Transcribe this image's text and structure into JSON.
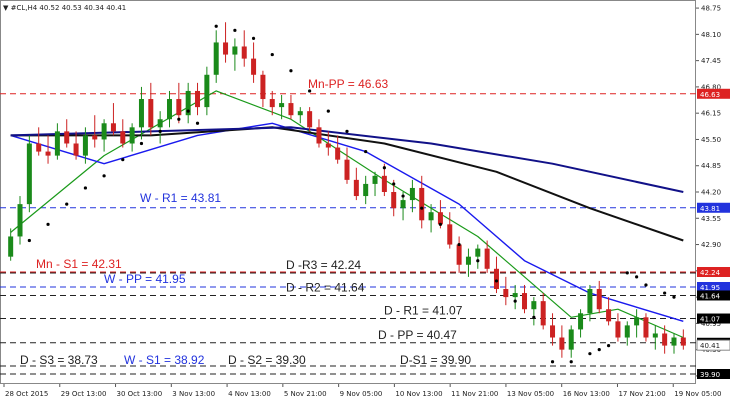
{
  "chart_data": {
    "type": "candlestick",
    "symbol_header": "▼ #CL,H4  40.52 40.53 40.34 40.41",
    "ylim": [
      39.45,
      48.95
    ],
    "y_ticks": [
      "48.75",
      "48.10",
      "47.45",
      "46.80",
      "46.15",
      "45.50",
      "44.85",
      "44.20",
      "43.55",
      "42.90",
      "42.25",
      "41.60",
      "40.95",
      "40.30",
      "39.65"
    ],
    "x_ticks": [
      "28 Oct 2015",
      "29 Oct 13:00",
      "30 Oct 13:00",
      "3 Nov 13:00",
      "4 Nov 13:00",
      "5 Nov 21:00",
      "9 Nov 05:00",
      "10 Nov 13:00",
      "11 Nov 21:00",
      "13 Nov 05:00",
      "16 Nov 13:00",
      "17 Nov 21:00",
      "19 Nov 05:00"
    ],
    "levels": [
      {
        "label": "Mn-PP = 46.63",
        "value": 46.63,
        "color": "#dd2222",
        "style": "dash",
        "tag": "46.63"
      },
      {
        "label": "W - R1 = 43.81",
        "value": 43.81,
        "color": "#2233dd",
        "style": "dash",
        "tag": "43.81"
      },
      {
        "label": "Mn - S1 = 42.31",
        "value": 42.31,
        "color": "#dd2222",
        "style": "dash",
        "tag": "42.24"
      },
      {
        "label": "W - PP = 41.95",
        "value": 41.95,
        "color": "#2233dd",
        "style": "dash",
        "tag": "41.95"
      },
      {
        "label": "D -R3 = 42.24",
        "value": 42.24,
        "color": "#222222",
        "style": "dash",
        "tag": ""
      },
      {
        "label": "D - R2 = 41.64",
        "value": 41.64,
        "color": "#222222",
        "style": "dash",
        "tag": "41.64"
      },
      {
        "label": "D - R1 = 41.07",
        "value": 41.07,
        "color": "#222222",
        "style": "dash",
        "tag": "41.07"
      },
      {
        "label": "D - PP = 40.47",
        "value": 40.47,
        "color": "#222222",
        "style": "dash",
        "tag": "40.47"
      },
      {
        "label": "D - S3 = 38.73",
        "value": 38.73,
        "color": "#222222",
        "style": "dash",
        "tag": ""
      },
      {
        "label": "W - S1 = 38.92",
        "value": 38.92,
        "color": "#2233dd",
        "style": "dash",
        "tag": ""
      },
      {
        "label": "D - S2 = 39.30",
        "value": 39.3,
        "color": "#222222",
        "style": "dash",
        "tag": ""
      },
      {
        "label": "D-S1 = 39.90",
        "value": 39.9,
        "color": "#222222",
        "style": "dash",
        "tag": "39.90"
      }
    ],
    "current_price": {
      "value": 40.41,
      "tag": "40.41"
    },
    "candles": [
      [
        42.6,
        43.3,
        42.5,
        43.1
      ],
      [
        43.1,
        44.1,
        42.9,
        43.9
      ],
      [
        43.9,
        45.6,
        43.7,
        45.4
      ],
      [
        45.4,
        45.8,
        45.1,
        45.2
      ],
      [
        45.2,
        45.6,
        44.9,
        45.1
      ],
      [
        45.1,
        45.9,
        45.0,
        45.7
      ],
      [
        45.7,
        46.0,
        45.3,
        45.4
      ],
      [
        45.4,
        45.7,
        45.0,
        45.1
      ],
      [
        45.1,
        45.8,
        44.9,
        45.6
      ],
      [
        45.6,
        46.1,
        45.3,
        45.5
      ],
      [
        45.5,
        46.0,
        45.2,
        45.9
      ],
      [
        45.9,
        46.4,
        45.6,
        45.7
      ],
      [
        45.7,
        46.0,
        45.3,
        45.4
      ],
      [
        45.4,
        45.9,
        45.2,
        45.8
      ],
      [
        45.8,
        46.8,
        45.5,
        46.5
      ],
      [
        46.5,
        46.9,
        45.6,
        45.8
      ],
      [
        45.8,
        46.2,
        45.4,
        46.0
      ],
      [
        46.0,
        46.7,
        45.8,
        46.5
      ],
      [
        46.5,
        46.9,
        45.9,
        46.1
      ],
      [
        46.1,
        46.9,
        45.9,
        46.7
      ],
      [
        46.7,
        46.9,
        46.1,
        46.3
      ],
      [
        46.3,
        47.3,
        46.1,
        47.1
      ],
      [
        47.1,
        48.2,
        46.9,
        47.9
      ],
      [
        47.9,
        48.4,
        47.4,
        47.6
      ],
      [
        47.6,
        48.0,
        47.2,
        47.8
      ],
      [
        47.8,
        48.2,
        47.3,
        47.5
      ],
      [
        47.5,
        47.9,
        46.9,
        47.1
      ],
      [
        47.1,
        47.2,
        46.3,
        46.5
      ],
      [
        46.5,
        46.7,
        46.1,
        46.3
      ],
      [
        46.3,
        46.6,
        46.0,
        46.4
      ],
      [
        46.4,
        46.6,
        46.0,
        46.1
      ],
      [
        46.1,
        46.3,
        45.9,
        46.2
      ],
      [
        46.2,
        46.3,
        45.7,
        45.8
      ],
      [
        45.8,
        46.0,
        45.3,
        45.4
      ],
      [
        45.4,
        45.7,
        45.1,
        45.3
      ],
      [
        45.3,
        45.6,
        44.9,
        45.0
      ],
      [
        45.0,
        45.3,
        44.4,
        44.5
      ],
      [
        44.5,
        44.8,
        44.0,
        44.1
      ],
      [
        44.1,
        44.6,
        43.9,
        44.4
      ],
      [
        44.4,
        44.7,
        44.1,
        44.6
      ],
      [
        44.6,
        44.9,
        44.1,
        44.2
      ],
      [
        44.2,
        44.5,
        43.6,
        43.8
      ],
      [
        43.8,
        44.2,
        43.5,
        44.0
      ],
      [
        44.0,
        44.5,
        43.7,
        44.3
      ],
      [
        44.3,
        44.6,
        43.3,
        43.5
      ],
      [
        43.5,
        43.9,
        43.2,
        43.7
      ],
      [
        43.7,
        44.0,
        43.3,
        43.4
      ],
      [
        43.4,
        43.7,
        42.8,
        42.9
      ],
      [
        42.9,
        43.1,
        42.2,
        42.4
      ],
      [
        42.4,
        42.8,
        42.1,
        42.6
      ],
      [
        42.6,
        42.9,
        42.3,
        42.8
      ],
      [
        42.8,
        43.0,
        42.2,
        42.3
      ],
      [
        42.3,
        42.6,
        41.7,
        41.8
      ],
      [
        41.8,
        42.1,
        41.4,
        41.6
      ],
      [
        41.6,
        41.9,
        41.3,
        41.7
      ],
      [
        41.7,
        41.9,
        41.2,
        41.3
      ],
      [
        41.3,
        41.6,
        40.9,
        41.5
      ],
      [
        41.5,
        41.7,
        40.8,
        40.9
      ],
      [
        40.9,
        41.2,
        40.4,
        40.6
      ],
      [
        40.6,
        40.9,
        40.1,
        40.3
      ],
      [
        40.3,
        40.9,
        40.1,
        40.8
      ],
      [
        40.8,
        41.3,
        40.6,
        41.2
      ],
      [
        41.2,
        41.9,
        41.0,
        41.8
      ],
      [
        41.8,
        42.0,
        41.2,
        41.3
      ],
      [
        41.3,
        41.6,
        40.9,
        41.0
      ],
      [
        41.0,
        41.2,
        40.5,
        40.6
      ],
      [
        40.6,
        41.0,
        40.4,
        40.9
      ],
      [
        40.9,
        41.3,
        40.6,
        41.1
      ],
      [
        41.1,
        41.2,
        40.5,
        40.6
      ],
      [
        40.6,
        40.9,
        40.3,
        40.7
      ],
      [
        40.7,
        40.9,
        40.2,
        40.4
      ],
      [
        40.4,
        40.7,
        40.2,
        40.6
      ],
      [
        40.6,
        40.8,
        40.3,
        40.4
      ]
    ],
    "moving_averages": [
      {
        "color": "#1a9a1a",
        "width": 1.2,
        "points": [
          [
            0,
            43.2
          ],
          [
            10,
            45.1
          ],
          [
            22,
            46.7
          ],
          [
            30,
            46.0
          ],
          [
            40,
            44.5
          ],
          [
            50,
            43.1
          ],
          [
            60,
            41.1
          ],
          [
            65,
            41.3
          ],
          [
            72,
            40.6
          ]
        ]
      },
      {
        "color": "#1a1aee",
        "width": 1.4,
        "points": [
          [
            0,
            45.6
          ],
          [
            10,
            44.9
          ],
          [
            20,
            45.6
          ],
          [
            28,
            45.9
          ],
          [
            38,
            45.2
          ],
          [
            48,
            43.9
          ],
          [
            55,
            42.5
          ],
          [
            62,
            41.7
          ],
          [
            72,
            41.0
          ]
        ]
      },
      {
        "color": "#111111",
        "width": 2.0,
        "points": [
          [
            0,
            45.6
          ],
          [
            15,
            45.6
          ],
          [
            28,
            45.8
          ],
          [
            40,
            45.4
          ],
          [
            52,
            44.7
          ],
          [
            62,
            43.8
          ],
          [
            72,
            43.0
          ]
        ]
      },
      {
        "color": "#111188",
        "width": 2.0,
        "points": [
          [
            0,
            45.6
          ],
          [
            15,
            45.7
          ],
          [
            30,
            45.8
          ],
          [
            45,
            45.4
          ],
          [
            58,
            44.9
          ],
          [
            72,
            44.2
          ]
        ]
      }
    ],
    "sar_dots": [
      [
        2,
        43.0
      ],
      [
        4,
        43.4
      ],
      [
        6,
        43.9
      ],
      [
        8,
        44.3
      ],
      [
        10,
        44.6
      ],
      [
        12,
        45.0
      ],
      [
        14,
        45.4
      ],
      [
        16,
        45.7
      ],
      [
        18,
        46.0
      ],
      [
        19,
        46.2
      ],
      [
        20,
        45.9
      ],
      [
        22,
        48.3
      ],
      [
        24,
        48.2
      ],
      [
        26,
        48.0
      ],
      [
        28,
        47.6
      ],
      [
        30,
        47.2
      ],
      [
        32,
        46.7
      ],
      [
        34,
        46.2
      ],
      [
        36,
        45.7
      ],
      [
        38,
        45.2
      ],
      [
        40,
        44.8
      ],
      [
        41,
        44.4
      ],
      [
        42,
        44.1
      ],
      [
        44,
        43.8
      ],
      [
        46,
        43.4
      ],
      [
        48,
        42.9
      ],
      [
        50,
        42.5
      ],
      [
        52,
        42.0
      ],
      [
        54,
        41.5
      ],
      [
        56,
        41.1
      ],
      [
        58,
        40.0
      ],
      [
        60,
        40.0
      ],
      [
        62,
        40.2
      ],
      [
        63,
        40.3
      ],
      [
        64,
        40.4
      ],
      [
        66,
        42.2
      ],
      [
        67,
        42.1
      ],
      [
        68,
        41.9
      ],
      [
        70,
        41.7
      ],
      [
        71,
        41.6
      ]
    ]
  }
}
